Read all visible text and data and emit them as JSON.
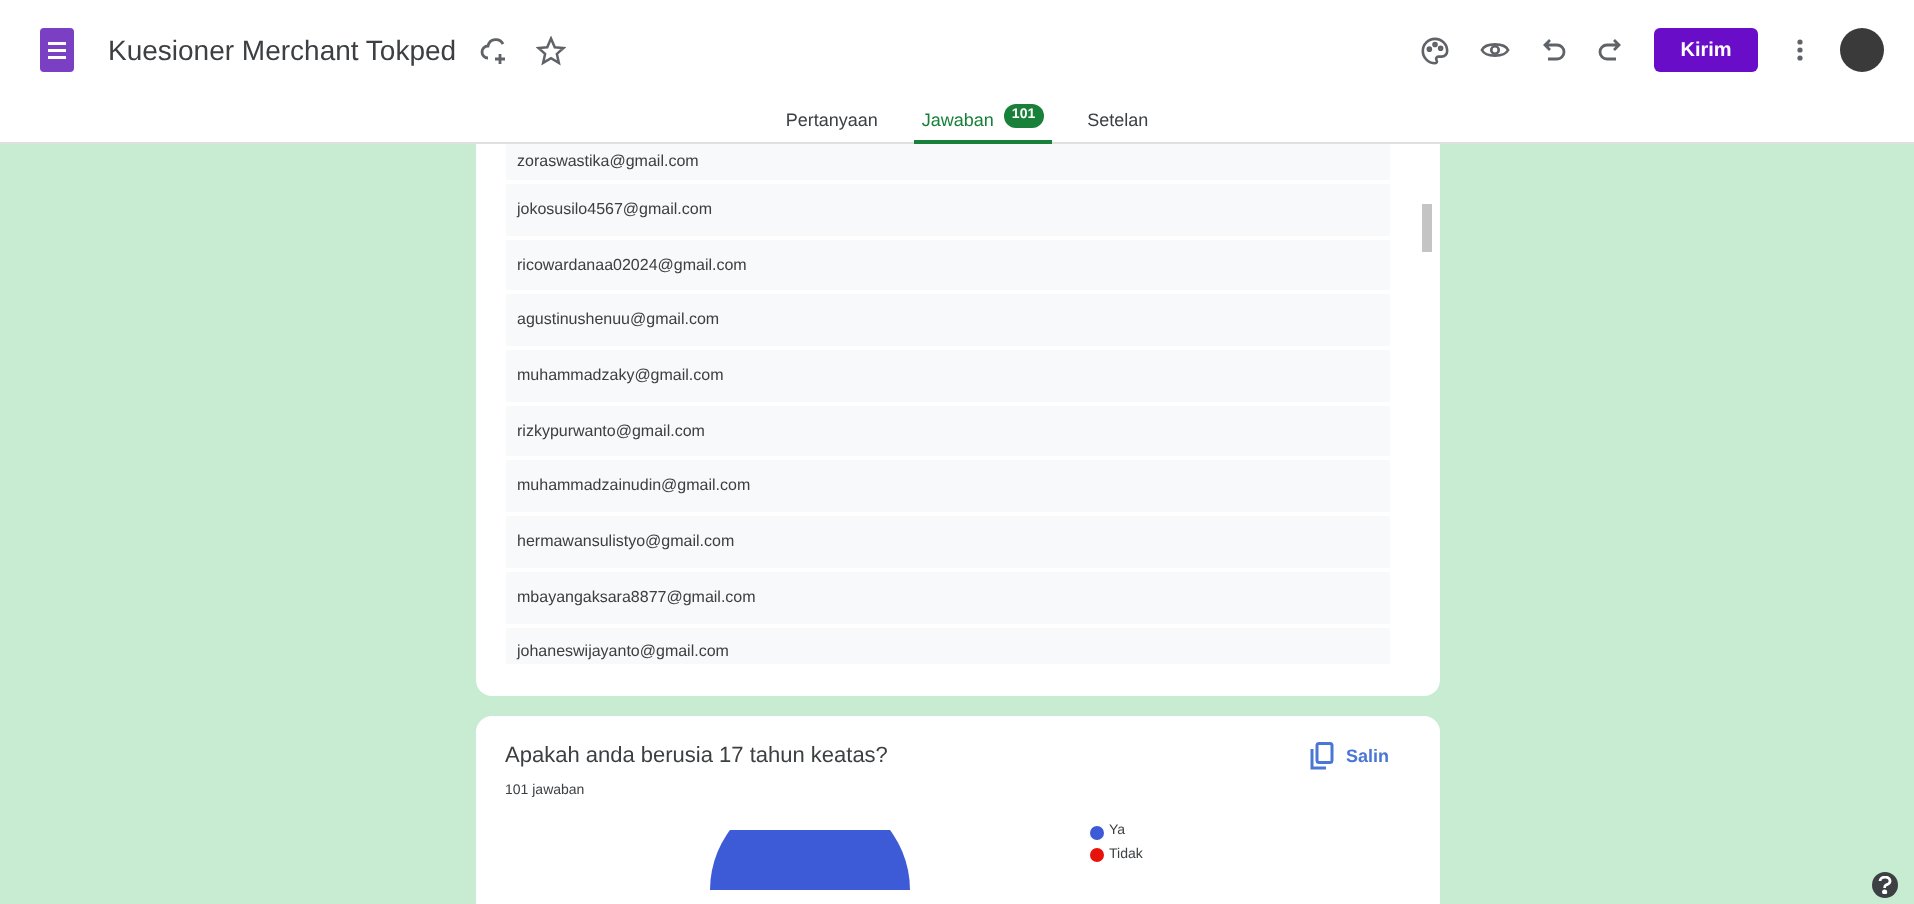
{
  "header": {
    "title": "Kuesioner Merchant Tokped",
    "send_button": "Kirim"
  },
  "tabs": [
    {
      "label": "Pertanyaan",
      "selected": false
    },
    {
      "label": "Jawaban",
      "badge": "101",
      "selected": true
    },
    {
      "label": "Setelan",
      "selected": false
    }
  ],
  "email_list": [
    "zoraswastika@gmail.com",
    "jokosusilo4567@gmail.com",
    "ricowardanaa02024@gmail.com",
    "agustinushenuu@gmail.com",
    "muhammadzaky@gmail.com",
    "rizkypurwanto@gmail.com",
    "muhammadzainudin@gmail.com",
    "hermawansulistyo@gmail.com",
    "mbayangaksara8877@gmail.com",
    "johaneswijayanto@gmail.com"
  ],
  "question_card": {
    "title": "Apakah anda berusia 17 tahun keatas?",
    "response_count": "101 jawaban",
    "copy_button": "Salin",
    "legend": [
      {
        "label": "Ya",
        "color": "#3d5bd6"
      },
      {
        "label": "Tidak",
        "color": "#e8120c"
      }
    ]
  }
}
